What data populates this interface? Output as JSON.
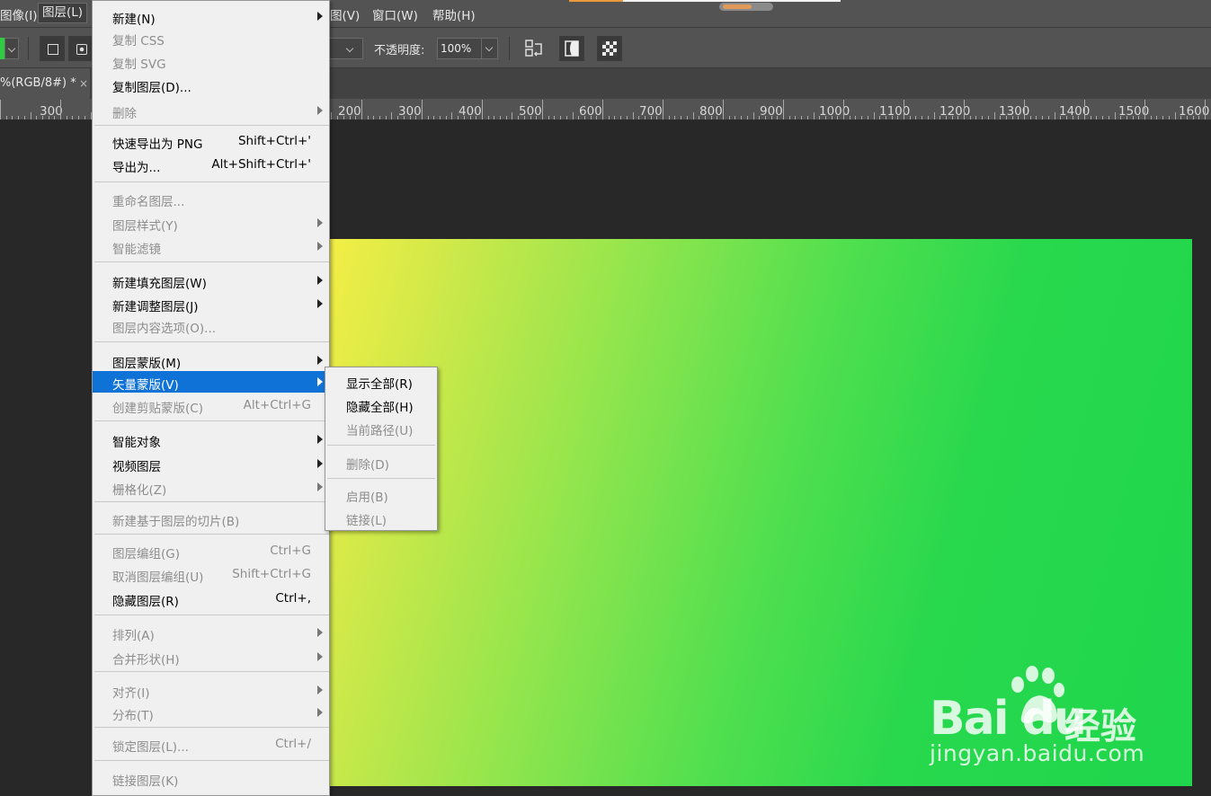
{
  "menubar": {
    "items": [
      {
        "label": "图像(I)"
      },
      {
        "label": "图层(L)"
      },
      {
        "label": "图(V)"
      },
      {
        "label": "窗口(W)"
      },
      {
        "label": "帮助(H)"
      }
    ]
  },
  "options": {
    "opacity_label": "不透明度:",
    "opacity_value": "100%"
  },
  "document": {
    "tab_title": "%(RGB/8#) *",
    "close_glyph": "×"
  },
  "ruler": {
    "labels": [
      "300",
      "200",
      "300",
      "400",
      "500",
      "600",
      "700",
      "800",
      "900",
      "1000",
      "1100",
      "1200",
      "1300",
      "1400",
      "1500",
      "1600"
    ]
  },
  "layer_menu": {
    "items": [
      {
        "label": "新建(N)",
        "shortcut": "",
        "enabled": true,
        "submenu": true
      },
      {
        "label": "复制 CSS",
        "shortcut": "",
        "enabled": false,
        "submenu": false
      },
      {
        "label": "复制 SVG",
        "shortcut": "",
        "enabled": false,
        "submenu": false
      },
      {
        "label": "复制图层(D)...",
        "shortcut": "",
        "enabled": true,
        "submenu": false
      },
      {
        "label": "删除",
        "shortcut": "",
        "enabled": false,
        "submenu": true
      },
      {
        "label": "快速导出为 PNG",
        "shortcut": "Shift+Ctrl+'",
        "enabled": true,
        "submenu": false
      },
      {
        "label": "导出为...",
        "shortcut": "Alt+Shift+Ctrl+'",
        "enabled": true,
        "submenu": false
      },
      {
        "label": "重命名图层...",
        "shortcut": "",
        "enabled": false,
        "submenu": false
      },
      {
        "label": "图层样式(Y)",
        "shortcut": "",
        "enabled": false,
        "submenu": true
      },
      {
        "label": "智能滤镜",
        "shortcut": "",
        "enabled": false,
        "submenu": true
      },
      {
        "label": "新建填充图层(W)",
        "shortcut": "",
        "enabled": true,
        "submenu": true
      },
      {
        "label": "新建调整图层(J)",
        "shortcut": "",
        "enabled": true,
        "submenu": true
      },
      {
        "label": "图层内容选项(O)...",
        "shortcut": "",
        "enabled": false,
        "submenu": false
      },
      {
        "label": "图层蒙版(M)",
        "shortcut": "",
        "enabled": true,
        "submenu": true
      },
      {
        "label": "矢量蒙版(V)",
        "shortcut": "",
        "enabled": true,
        "submenu": true,
        "selected": true
      },
      {
        "label": "创建剪贴蒙版(C)",
        "shortcut": "Alt+Ctrl+G",
        "enabled": false,
        "submenu": false
      },
      {
        "label": "智能对象",
        "shortcut": "",
        "enabled": true,
        "submenu": true
      },
      {
        "label": "视频图层",
        "shortcut": "",
        "enabled": true,
        "submenu": true
      },
      {
        "label": "栅格化(Z)",
        "shortcut": "",
        "enabled": false,
        "submenu": true
      },
      {
        "label": "新建基于图层的切片(B)",
        "shortcut": "",
        "enabled": false,
        "submenu": false
      },
      {
        "label": "图层编组(G)",
        "shortcut": "Ctrl+G",
        "enabled": false,
        "submenu": false
      },
      {
        "label": "取消图层编组(U)",
        "shortcut": "Shift+Ctrl+G",
        "enabled": false,
        "submenu": false
      },
      {
        "label": "隐藏图层(R)",
        "shortcut": "Ctrl+,",
        "enabled": true,
        "submenu": false
      },
      {
        "label": "排列(A)",
        "shortcut": "",
        "enabled": false,
        "submenu": true
      },
      {
        "label": "合并形状(H)",
        "shortcut": "",
        "enabled": false,
        "submenu": true
      },
      {
        "label": "对齐(I)",
        "shortcut": "",
        "enabled": false,
        "submenu": true
      },
      {
        "label": "分布(T)",
        "shortcut": "",
        "enabled": false,
        "submenu": true
      },
      {
        "label": "锁定图层(L)...",
        "shortcut": "Ctrl+/",
        "enabled": false,
        "submenu": false
      },
      {
        "label": "链接图层(K)",
        "shortcut": "",
        "enabled": false,
        "submenu": false
      }
    ]
  },
  "vector_mask_submenu": {
    "items": [
      {
        "label": "显示全部(R)",
        "enabled": true
      },
      {
        "label": "隐藏全部(H)",
        "enabled": true
      },
      {
        "label": "当前路径(U)",
        "enabled": false
      },
      {
        "label": "删除(D)",
        "enabled": false
      },
      {
        "label": "启用(B)",
        "enabled": false
      },
      {
        "label": "链接(L)",
        "enabled": false
      }
    ]
  },
  "watermark": {
    "brand": "Bai du",
    "product": "经验",
    "url": "jingyan.baidu.com"
  },
  "colors": {
    "menu_highlight": "#0f72d6",
    "gradient_start": "#f4ee45",
    "gradient_end": "#1fd64c",
    "ui_panel": "#535353",
    "workspace": "#282828"
  }
}
